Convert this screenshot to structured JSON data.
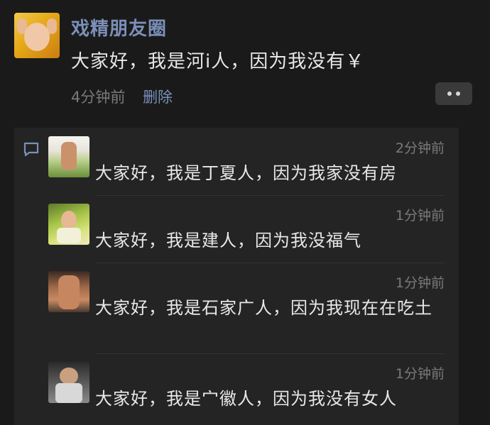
{
  "post": {
    "author": "戏精朋友圈",
    "text": "大家好，我是河i人，因为我没有￥",
    "time": "4分钟前",
    "delete_label": "删除"
  },
  "comments": [
    {
      "time": "2分钟前",
      "text": "大家好，我是丁夏人，因为我家没有房"
    },
    {
      "time": "1分钟前",
      "text": "大家好，我是建人，因为我没福气"
    },
    {
      "time": "1分钟前",
      "text": "大家好，我是石家广人，因为我现在在吃土"
    },
    {
      "time": "1分钟前",
      "text": "大家好，我是宀徽人，因为我没有女人"
    }
  ],
  "icons": {
    "more": "more-dots-icon",
    "comment": "comment-bubble-icon"
  },
  "colors": {
    "background": "#1a1a1a",
    "link": "#7b8fb8",
    "text": "#e8e8e8",
    "muted": "#7a7a7a"
  }
}
